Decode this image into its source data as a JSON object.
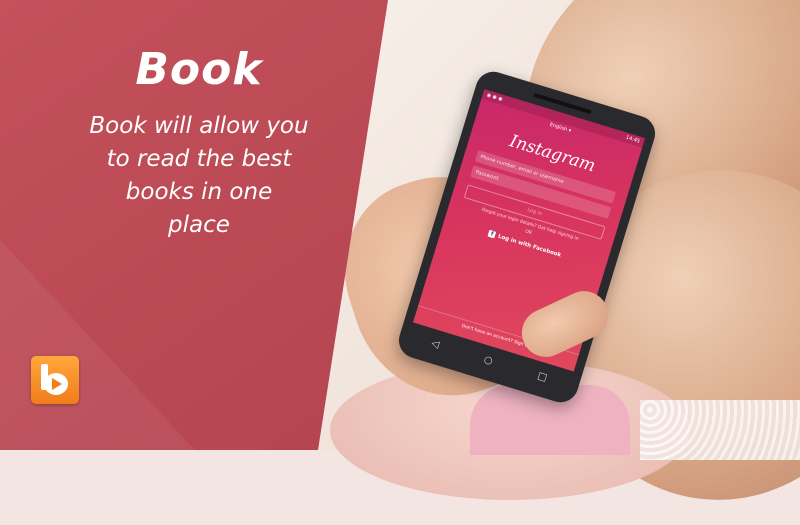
{
  "banner": {
    "title": "Book",
    "subtitle_lines": [
      "Book will allow you",
      "to read the best",
      "books in one",
      "place"
    ],
    "logo_icon": "book-play-logo-icon",
    "colors": {
      "panel": "#b84853",
      "logo": "#f08a22",
      "text": "#ffffff"
    }
  },
  "phone": {
    "status_time": "14:45",
    "language": "English ▾",
    "app_name": "Instagram",
    "username_placeholder": "Phone number, email or username",
    "password_placeholder": "Password",
    "login_label": "Log in",
    "forgot_text": "Forgot your login details? Get help signing in.",
    "or_text": "OR",
    "facebook_label": "Log in with Facebook",
    "signup_text": "Don't have an account? Sign up."
  }
}
